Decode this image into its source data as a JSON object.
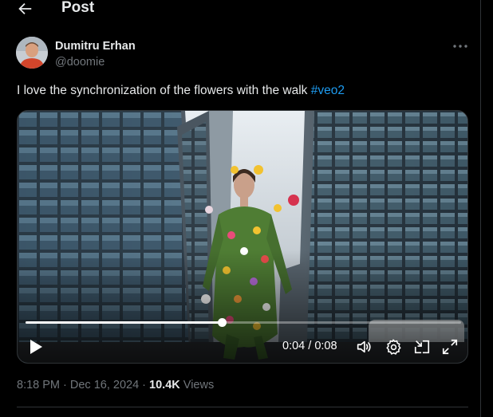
{
  "header": {
    "back_icon": "arrow-left-icon",
    "title": "Post"
  },
  "author": {
    "name": "Dumitru Erhan",
    "handle": "@doomie",
    "avatar_icon": "user-avatar"
  },
  "more_icon": "more-horizontal-icon",
  "post": {
    "text": "I love the synchronization of the flowers with the walk ",
    "hashtag": "#veo2"
  },
  "video": {
    "current_time": "0:04",
    "separator": " / ",
    "duration": "0:08",
    "progress": 0.45,
    "controls": {
      "play": "play-icon",
      "volume": "volume-icon",
      "settings": "gear-icon",
      "pip": "picture-in-picture-icon",
      "fullscreen": "fullscreen-icon"
    }
  },
  "meta": {
    "time": "8:18 PM",
    "sep1": " · ",
    "date": "Dec 16, 2024",
    "sep2": " · ",
    "views_count": "10.4K",
    "views_label": " Views"
  },
  "colors": {
    "background": "#000000",
    "text": "#e7e9ea",
    "muted": "#71767b",
    "link": "#1d9bf0",
    "border": "#2f3336"
  }
}
